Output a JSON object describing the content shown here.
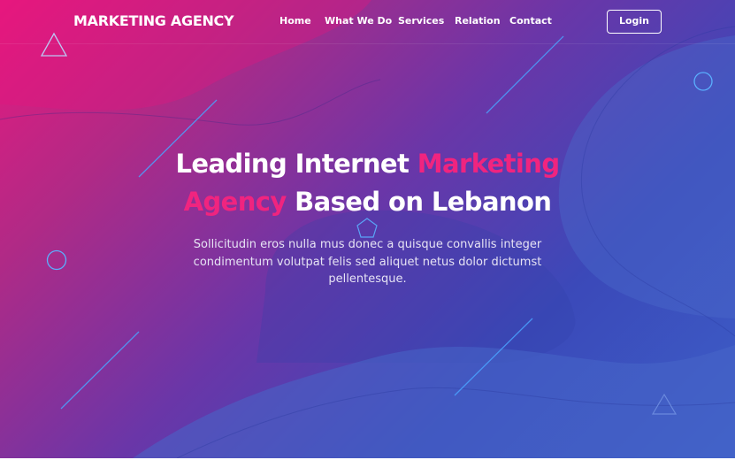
{
  "header": {
    "brand": "MARKETING AGENCY",
    "nav": [
      "Home",
      "What We Do",
      "Services",
      "Relation",
      "Contact"
    ],
    "login_label": "Login"
  },
  "hero": {
    "headline_line1_white": "Leading Internet ",
    "headline_line1_pink": "Marketing",
    "headline_line2_pink": "Agency",
    "headline_line2_white": " Based on Lebanon",
    "subtext": "Sollicitudin eros nulla mus donec a quisque convallis integer condimentum volutpat felis sed aliquet netus dolor dictumst pellentesque."
  },
  "colors": {
    "accent_pink": "#f0247f",
    "gradient_start": "#e8197e",
    "gradient_end": "#3c5fc8",
    "decor_line": "#4aa3ff"
  }
}
